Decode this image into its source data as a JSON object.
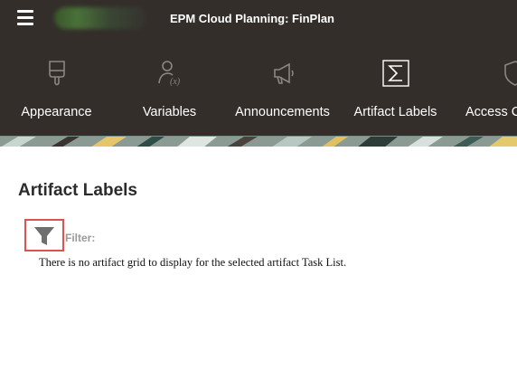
{
  "header": {
    "title": "EPM Cloud Planning: FinPlan",
    "menu_icon": "hamburger-menu-icon",
    "logo": "oracle-logo"
  },
  "nav": {
    "items": [
      {
        "label": "Appearance",
        "icon": "paint-brush-icon"
      },
      {
        "label": "Variables",
        "icon": "user-variable-icon"
      },
      {
        "label": "Announcements",
        "icon": "megaphone-icon"
      },
      {
        "label": "Artifact Labels",
        "icon": "sigma-icon"
      },
      {
        "label": "Access Control",
        "icon": "shield-icon"
      }
    ]
  },
  "main": {
    "title": "Artifact Labels",
    "filter_label": "Filter:",
    "filter_icon": "funnel-icon",
    "message": "There is no artifact grid to display for the selected artifact Task List."
  },
  "colors": {
    "header_bg": "#332e2a",
    "highlight_border": "#d9534f"
  }
}
